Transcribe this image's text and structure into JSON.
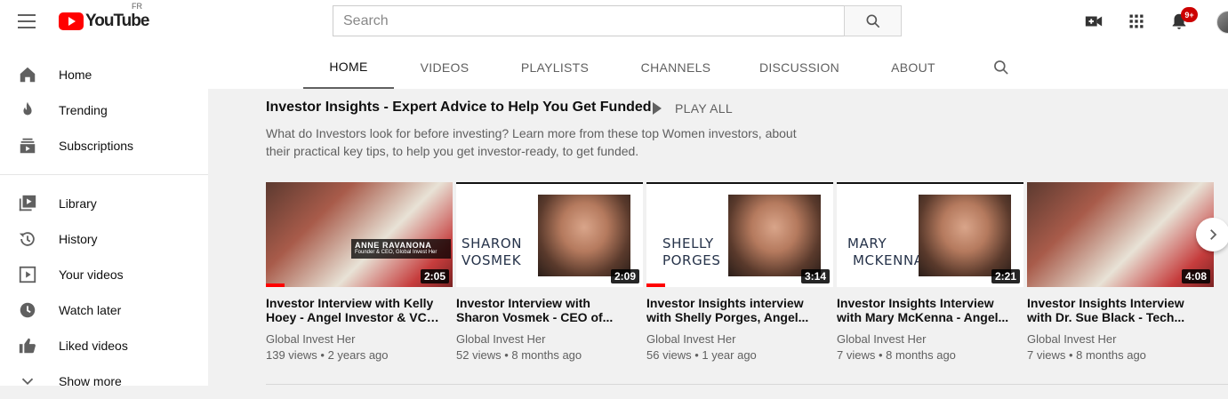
{
  "header": {
    "logo_text": "YouTube",
    "logo_region": "FR",
    "search_placeholder": "Search",
    "notifications_count": "9+"
  },
  "sidebar": {
    "items": [
      {
        "label": "Home",
        "icon": "home-icon"
      },
      {
        "label": "Trending",
        "icon": "trending-icon"
      },
      {
        "label": "Subscriptions",
        "icon": "subscriptions-icon"
      },
      {
        "label": "Library",
        "icon": "library-icon"
      },
      {
        "label": "History",
        "icon": "history-icon"
      },
      {
        "label": "Your videos",
        "icon": "your-videos-icon"
      },
      {
        "label": "Watch later",
        "icon": "watch-later-icon"
      },
      {
        "label": "Liked videos",
        "icon": "liked-videos-icon"
      },
      {
        "label": "Show more",
        "icon": "chevron-down-icon"
      }
    ]
  },
  "tabs": [
    {
      "label": "HOME",
      "active": true
    },
    {
      "label": "VIDEOS",
      "active": false
    },
    {
      "label": "PLAYLISTS",
      "active": false
    },
    {
      "label": "CHANNELS",
      "active": false
    },
    {
      "label": "DISCUSSION",
      "active": false
    },
    {
      "label": "ABOUT",
      "active": false
    }
  ],
  "shelf": {
    "title": "Investor Insights - Expert Advice to Help You Get Funded",
    "play_all": "PLAY ALL",
    "description_line1": "What do Investors look for before investing? Learn more from these top Women investors, about",
    "description_line2": "their practical key tips, to help you get investor-ready, to get funded."
  },
  "videos": [
    {
      "title_line1": "Investor Interview with Kelly",
      "title_line2": "Hoey - Angel Investor & VC ...",
      "channel": "Global Invest Her",
      "meta": "139 views • 2 years ago",
      "duration": "2:05",
      "thumb_caption_name": "ANNE RAVANONA",
      "thumb_caption_role": "Founder & CEO, Global Invest Her",
      "watched_fraction": 0.1
    },
    {
      "title_line1": "Investor Interview with",
      "title_line2": "Sharon Vosmek - CEO of...",
      "channel": "Global Invest Her",
      "meta": "52 views • 8 months ago",
      "duration": "2:09",
      "thumb_name_line1": "SHARON",
      "thumb_name_line2": "VOSMEK",
      "watched_fraction": 0
    },
    {
      "title_line1": "Investor Insights interview",
      "title_line2": "with Shelly Porges, Angel...",
      "channel": "Global Invest Her",
      "meta": "56 views • 1 year ago",
      "duration": "3:14",
      "thumb_name_line1": "SHELLY",
      "thumb_name_line2": "PORGES",
      "watched_fraction": 0.1
    },
    {
      "title_line1": "Investor Insights Interview",
      "title_line2": "with Mary McKenna - Angel...",
      "channel": "Global Invest Her",
      "meta": "7 views • 8 months ago",
      "duration": "2:21",
      "thumb_name_line1": "MARY",
      "thumb_name_line2": "MCKENNA",
      "watched_fraction": 0
    },
    {
      "title_line1": "Investor Insights Interview",
      "title_line2": "with Dr. Sue Black - Tech...",
      "channel": "Global Invest Her",
      "meta": "7 views • 8 months ago",
      "duration": "4:08",
      "watched_fraction": 0
    }
  ]
}
